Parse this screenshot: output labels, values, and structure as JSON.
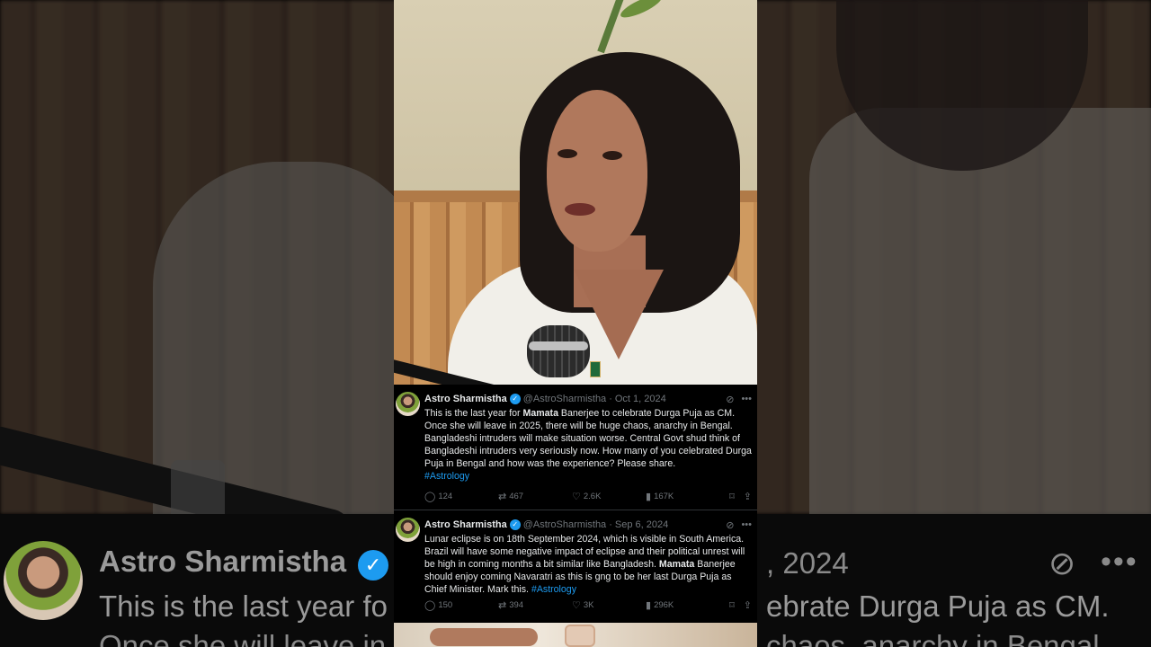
{
  "tweets": [
    {
      "name": "Astro Sharmistha",
      "handle": "@AstroSharmistha",
      "date": "Oct 1, 2024",
      "text_before": "This is the last year for ",
      "bold": "Mamata",
      "text_after": " Banerjee to celebrate Durga Puja as CM. Once she will leave in 2025, there will be huge chaos, anarchy in Bengal. Bangladeshi intruders will make situation worse. Central Govt shud think of Bangladeshi intruders very seriously now. How many of you celebrated Durga Puja in Bengal and how was the experience? Please share.",
      "hashtag": "#Astrology",
      "replies": "124",
      "reposts": "467",
      "likes": "2.6K",
      "views": "167K"
    },
    {
      "name": "Astro Sharmistha",
      "handle": "@AstroSharmistha",
      "date": "Sep 6, 2024",
      "text_before": "Lunar eclipse is on 18th September 2024, which is visible in South America. Brazil will have some negative impact of eclipse and their political unrest will be high in coming months a bit similar like Bangladesh. ",
      "bold": "Mamata",
      "text_after": " Banerjee should enjoy coming Navaratri as this is gng to be her last Durga Puja as Chief Minister. Mark this.",
      "hashtag": "#Astrology",
      "replies": "150",
      "reposts": "394",
      "likes": "3K",
      "views": "296K"
    }
  ],
  "background_zoom": {
    "name": "Astro Sharmistha",
    "date": ", 2024",
    "line1_left": "This is the last year fo",
    "line1_right": "ebrate Durga Puja as CM.",
    "line2_left": "Once she will leave in",
    "line2_right": "chaos, anarchy in Bengal"
  },
  "icons": {
    "verified": "verified-check-icon",
    "grok": "grok-icon",
    "more": "more-icon",
    "reply": "reply-icon",
    "repost": "repost-icon",
    "like": "heart-icon",
    "views": "views-chart-icon",
    "bookmark": "bookmark-icon",
    "share": "share-icon"
  },
  "colors": {
    "link": "#1d9bf0",
    "muted": "#71767b",
    "text": "#e7e9ea",
    "background": "#000000"
  }
}
